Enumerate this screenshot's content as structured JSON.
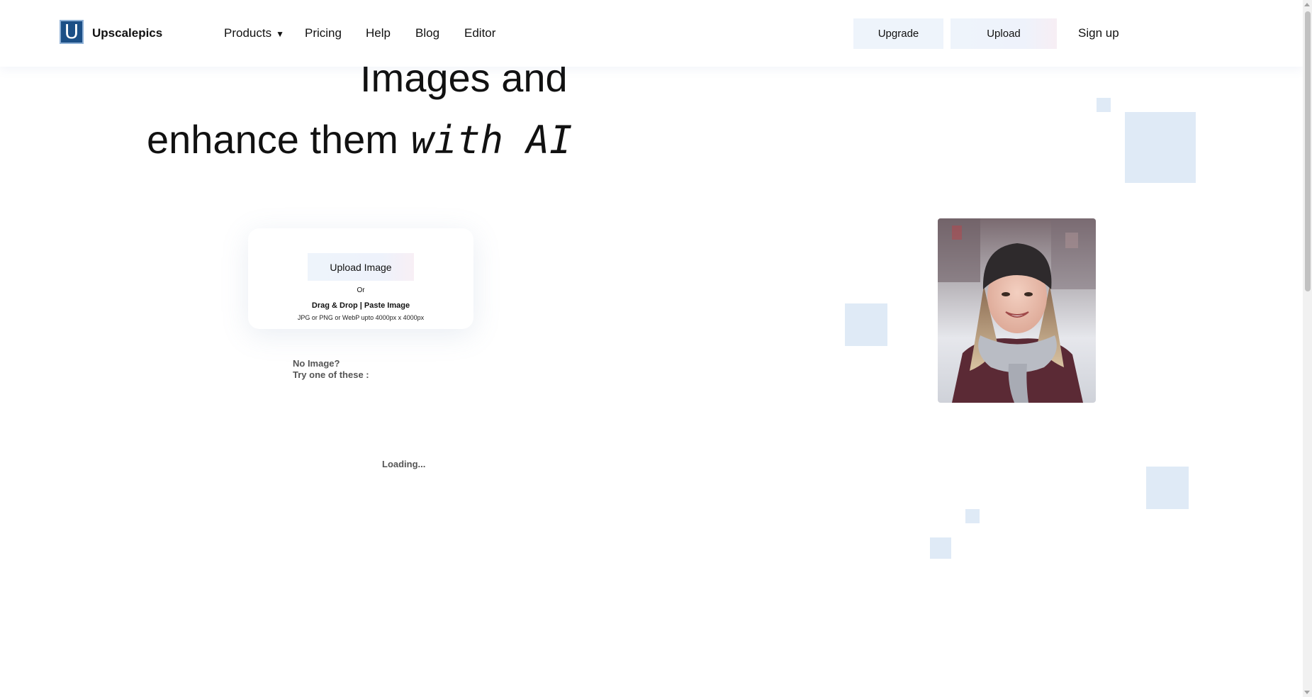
{
  "header": {
    "logo_letter": "U",
    "brand": "Upscalepics",
    "nav": [
      {
        "label": "Products",
        "caret": "▼"
      },
      {
        "label": "Pricing"
      },
      {
        "label": "Help"
      },
      {
        "label": "Blog"
      },
      {
        "label": "Editor"
      }
    ],
    "upgrade_label": "Upgrade",
    "upload_label": "Upload",
    "signup_label": "Sign up"
  },
  "hero": {
    "line1": "Images and",
    "line2_plain": "enhance them",
    "line2_accent": "with AI"
  },
  "upload_card": {
    "button_label": "Upload Image",
    "or_text": "Or",
    "dnd_text": "Drag & Drop | Paste Image",
    "formats_text": "JPG or PNG or WebP upto 4000px x 4000px"
  },
  "samples": {
    "line1": "No Image?",
    "line2": "Try one of these :",
    "loading": "Loading..."
  },
  "colors": {
    "brand_blue": "#1b4f86",
    "button_bg": "#eef4fb",
    "decor_square": "#dfeaf6"
  },
  "icons": {
    "caret": "chevron-down-icon"
  }
}
